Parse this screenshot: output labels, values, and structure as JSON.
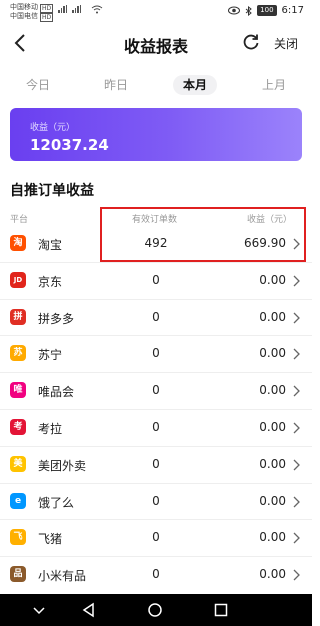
{
  "status": {
    "carrier1": "中国移动",
    "carrier2": "中国电信",
    "hd1": "HD",
    "hd2": "HD",
    "battery": "100",
    "time": "6:17"
  },
  "header": {
    "title": "收益报表",
    "close_label": "关闭"
  },
  "tabs": [
    {
      "label": "今日",
      "active": false
    },
    {
      "label": "昨日",
      "active": false
    },
    {
      "label": "本月",
      "active": true
    },
    {
      "label": "上月",
      "active": false
    }
  ],
  "summary": {
    "label": "收益（元）",
    "value": "12037.24"
  },
  "section": {
    "title": "自推订单收益"
  },
  "table": {
    "headers": [
      "平台",
      "有效订单数",
      "收益（元）"
    ],
    "rows": [
      {
        "platform": "淘宝",
        "logo": "taobao-logo",
        "logo_char": "淘",
        "color": "#ff5000",
        "orders": "492",
        "income": "669.90"
      },
      {
        "platform": "京东",
        "logo": "jd-logo",
        "logo_char": "JD",
        "color": "#e1251b",
        "orders": "0",
        "income": "0.00"
      },
      {
        "platform": "拼多多",
        "logo": "pinduoduo-logo",
        "logo_char": "拼",
        "color": "#e02e24",
        "orders": "0",
        "income": "0.00"
      },
      {
        "platform": "苏宁",
        "logo": "suning-logo",
        "logo_char": "苏",
        "color": "#ffaa00",
        "orders": "0",
        "income": "0.00"
      },
      {
        "platform": "唯品会",
        "logo": "vipshop-logo",
        "logo_char": "唯",
        "color": "#f10180",
        "orders": "0",
        "income": "0.00"
      },
      {
        "platform": "考拉",
        "logo": "kaola-logo",
        "logo_char": "考",
        "color": "#e31436",
        "orders": "0",
        "income": "0.00"
      },
      {
        "platform": "美团外卖",
        "logo": "meituan-logo",
        "logo_char": "美",
        "color": "#ffc300",
        "orders": "0",
        "income": "0.00"
      },
      {
        "platform": "饿了么",
        "logo": "eleme-logo",
        "logo_char": "e",
        "color": "#0097ff",
        "orders": "0",
        "income": "0.00"
      },
      {
        "platform": "飞猪",
        "logo": "fliggy-logo",
        "logo_char": "飞",
        "color": "#ffb000",
        "orders": "0",
        "income": "0.00"
      },
      {
        "platform": "小米有品",
        "logo": "youpin-logo",
        "logo_char": "品",
        "color": "#8b5a2b",
        "orders": "0",
        "income": "0.00"
      }
    ]
  },
  "colors": {
    "accent": "#6a3ff0",
    "highlight": "#e02020"
  }
}
